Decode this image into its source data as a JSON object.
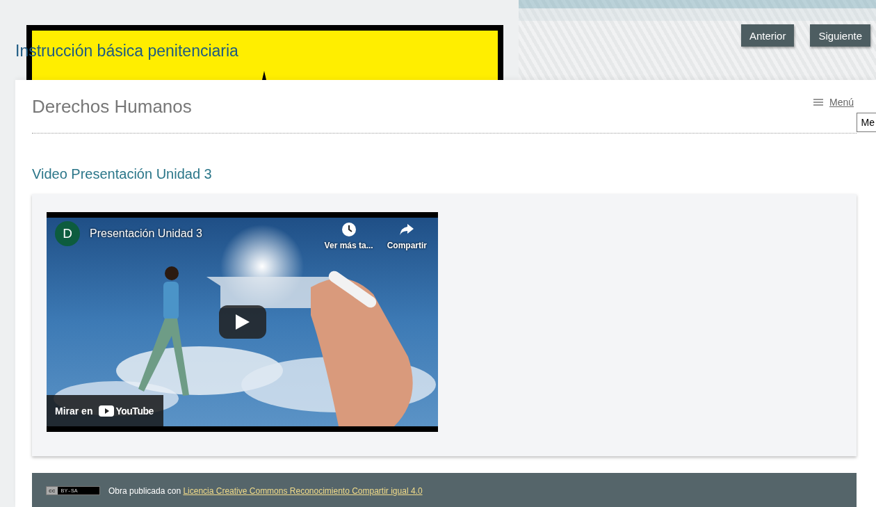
{
  "site_title": "Instrucción básica penitenciaria",
  "nav_buttons": [
    {
      "label": "Anterior"
    },
    {
      "label": "Siguiente"
    }
  ],
  "page": {
    "title": "Derechos Humanos",
    "menu_link": "Menú",
    "tooltip": "Me"
  },
  "section": {
    "heading": "Video Presentación Unidad 3",
    "video": {
      "channel_initial": "D",
      "title": "Presentación Unidad 3",
      "actions": [
        {
          "kind": "watch_later",
          "label": "Ver más ta..."
        },
        {
          "kind": "share",
          "label": "Compartir"
        }
      ],
      "watch_on": "Mirar en",
      "platform": "YouTube"
    }
  },
  "footer": {
    "badge": [
      "cc",
      "BY-SA"
    ],
    "text": "Obra publicada con",
    "link": "Licencia Creative Commons Reconocimiento Compartir igual 4.0"
  }
}
